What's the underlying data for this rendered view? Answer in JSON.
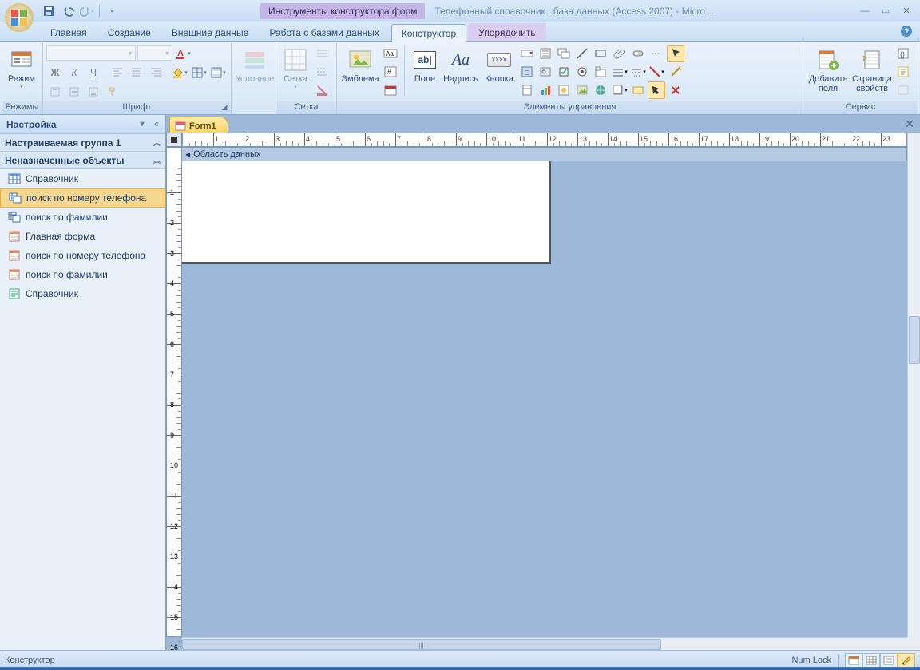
{
  "window": {
    "context_tool_title": "Инструменты конструктора форм",
    "document_title": "Телефонный справочник : база данных (Access 2007) - Micro…"
  },
  "qat": {
    "save": "save-icon",
    "undo": "undo-icon",
    "redo": "redo-icon",
    "more": "▾"
  },
  "tabs": {
    "home": "Главная",
    "create": "Создание",
    "external": "Внешние данные",
    "dbtools": "Работа с базами данных",
    "design": "Конструктор",
    "arrange": "Упорядочить"
  },
  "ribbon": {
    "views_group": "Режимы",
    "view_btn": "Режим",
    "font_group": "Шрифт",
    "conditional_btn": "Условное",
    "grid_group": "Сетка",
    "grid_btn": "Сетка",
    "controls_group": "Элементы управления",
    "logo_btn": "Эмблема",
    "field_btn": "Поле",
    "label_btn": "Надпись",
    "button_btn": "Кнопка",
    "addfields_btn": "Добавить поля",
    "propsheet_btn": "Страница свойств",
    "tools_group": "Сервис",
    "font_placeholder": "",
    "field_glyph": "ab|",
    "label_glyph": "Aa",
    "button_glyph": "XXXX"
  },
  "nav": {
    "header": "Настройка",
    "group1": "Настраиваемая группа 1",
    "group2": "Неназначенные объекты",
    "items": [
      {
        "type": "table",
        "label": "Справочник"
      },
      {
        "type": "query",
        "label": "поиск по номеру телефона",
        "selected": true
      },
      {
        "type": "query",
        "label": "поиск по фамилии"
      },
      {
        "type": "form",
        "label": "Главная форма"
      },
      {
        "type": "form",
        "label": "поиск по номеру телефона"
      },
      {
        "type": "form",
        "label": "поиск по фамилии"
      },
      {
        "type": "report",
        "label": "Справочник"
      }
    ]
  },
  "doc": {
    "tab_label": "Form1",
    "section_header": "Область данных"
  },
  "ruler": {
    "max_h": 23,
    "max_v": 16
  },
  "status": {
    "left": "Конструктор",
    "numlock": "Num Lock"
  }
}
